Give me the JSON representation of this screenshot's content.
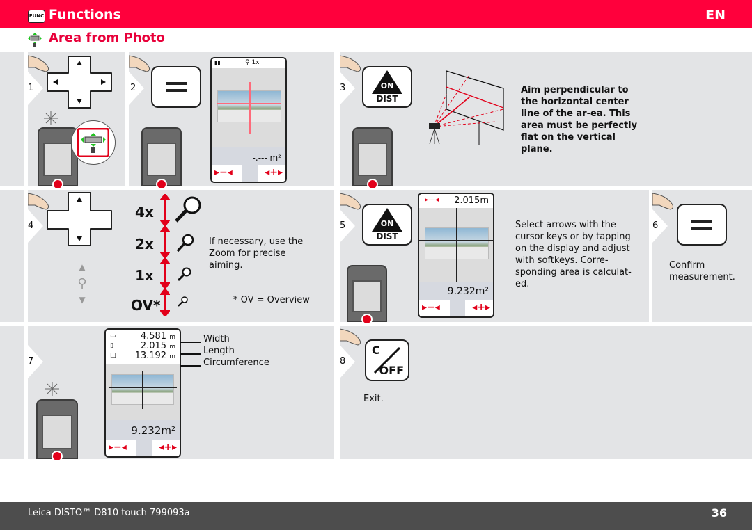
{
  "header": {
    "func_badge": "FUNC",
    "title": "Functions",
    "language": "EN",
    "subtitle": "Area from Photo"
  },
  "colors": {
    "brand_red": "#ff003c",
    "subtitle_red": "#e8003a",
    "panel_gray": "#e3e4e6",
    "footer_gray": "#4d4d4d",
    "guide_green": "#22c322"
  },
  "steps": [
    {
      "num": "1",
      "icons": [
        "hand-icon",
        "dpad-icon",
        "device-icon",
        "area-from-photo-icon"
      ]
    },
    {
      "num": "2",
      "icons": [
        "hand-icon",
        "equals-key-icon",
        "device-icon"
      ],
      "screen": {
        "zoom_label": "1x",
        "result": "-.--- m²",
        "softkeys": [
          "minus",
          "mode",
          "plus"
        ]
      }
    },
    {
      "num": "3",
      "key_top": "ON",
      "key_bottom": "DIST",
      "text": "Aim perpendicular to the horizontal center line of the ar-ea. This area must be perfectly flat on the vertical plane."
    },
    {
      "num": "4",
      "zoom_levels": [
        "4x",
        "2x",
        "1x",
        "OV*"
      ],
      "text": "If necessary, use the Zoom for precise aiming.",
      "footnote": "* OV = Overview"
    },
    {
      "num": "5",
      "key_top": "ON",
      "key_bottom": "DIST",
      "screen": {
        "top_value": "2.015m",
        "result": "9.232m²"
      },
      "text": "Select arrows with the cursor keys or by tapping on the display and adjust with softkeys. Corre-sponding area is calculat-ed."
    },
    {
      "num": "6",
      "text": "Confirm measurement."
    },
    {
      "num": "7",
      "screen": {
        "rows": [
          {
            "icon": "width-icon",
            "value": "4.581",
            "unit": "m",
            "label": "Width"
          },
          {
            "icon": "length-icon",
            "value": "2.015",
            "unit": "m",
            "label": "Length"
          },
          {
            "icon": "circumference-icon",
            "value": "13.192",
            "unit": "m",
            "label": "Circumference"
          }
        ],
        "result": "9.232m²"
      }
    },
    {
      "num": "8",
      "key_top": "C",
      "key_bottom": "OFF",
      "text": "Exit."
    }
  ],
  "footer": {
    "product": "Leica DISTO™ D810 touch 799093a",
    "page": "36"
  }
}
